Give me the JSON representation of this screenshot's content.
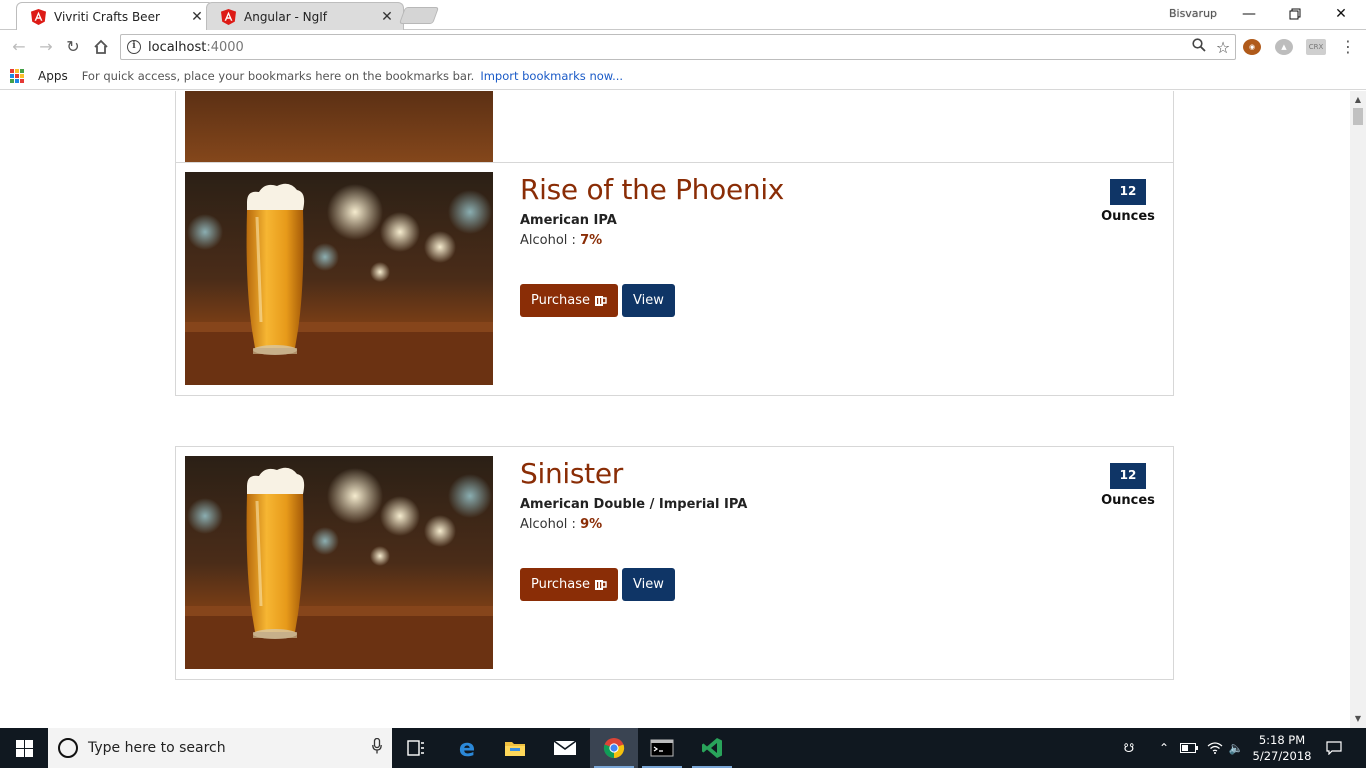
{
  "browser": {
    "tabs": [
      {
        "title": "Vivriti Crafts Beer",
        "active": true
      },
      {
        "title": "Angular - NgIf",
        "active": false
      }
    ],
    "profile_name": "Bisvarup",
    "url_host": "localhost",
    "url_port": ":4000",
    "bookmarks": {
      "apps_label": "Apps",
      "hint": "For quick access, place your bookmarks here on the bookmarks bar.",
      "import_link": "Import bookmarks now..."
    },
    "icons": {
      "minimize": "minimize-icon",
      "restore": "restore-icon",
      "close": "close-icon"
    },
    "extensions": {
      "crx_label": "CRX"
    }
  },
  "beers": [
    {
      "name": "Rise of the Phoenix",
      "style": "American IPA",
      "alcohol_label": "Alcohol : ",
      "abv": "7%",
      "ounces": "12",
      "ounces_label": "Ounces",
      "purchase_label": "Purchase",
      "view_label": "View"
    },
    {
      "name": "Sinister",
      "style": "American Double / Imperial IPA",
      "alcohol_label": "Alcohol : ",
      "abv": "9%",
      "ounces": "12",
      "ounces_label": "Ounces",
      "purchase_label": "Purchase",
      "view_label": "View"
    }
  ],
  "taskbar": {
    "search_placeholder": "Type here to search",
    "time": "5:18 PM",
    "date": "5/27/2018"
  },
  "colors": {
    "accent_brown": "#8a2d06",
    "accent_navy": "#0f3566"
  }
}
